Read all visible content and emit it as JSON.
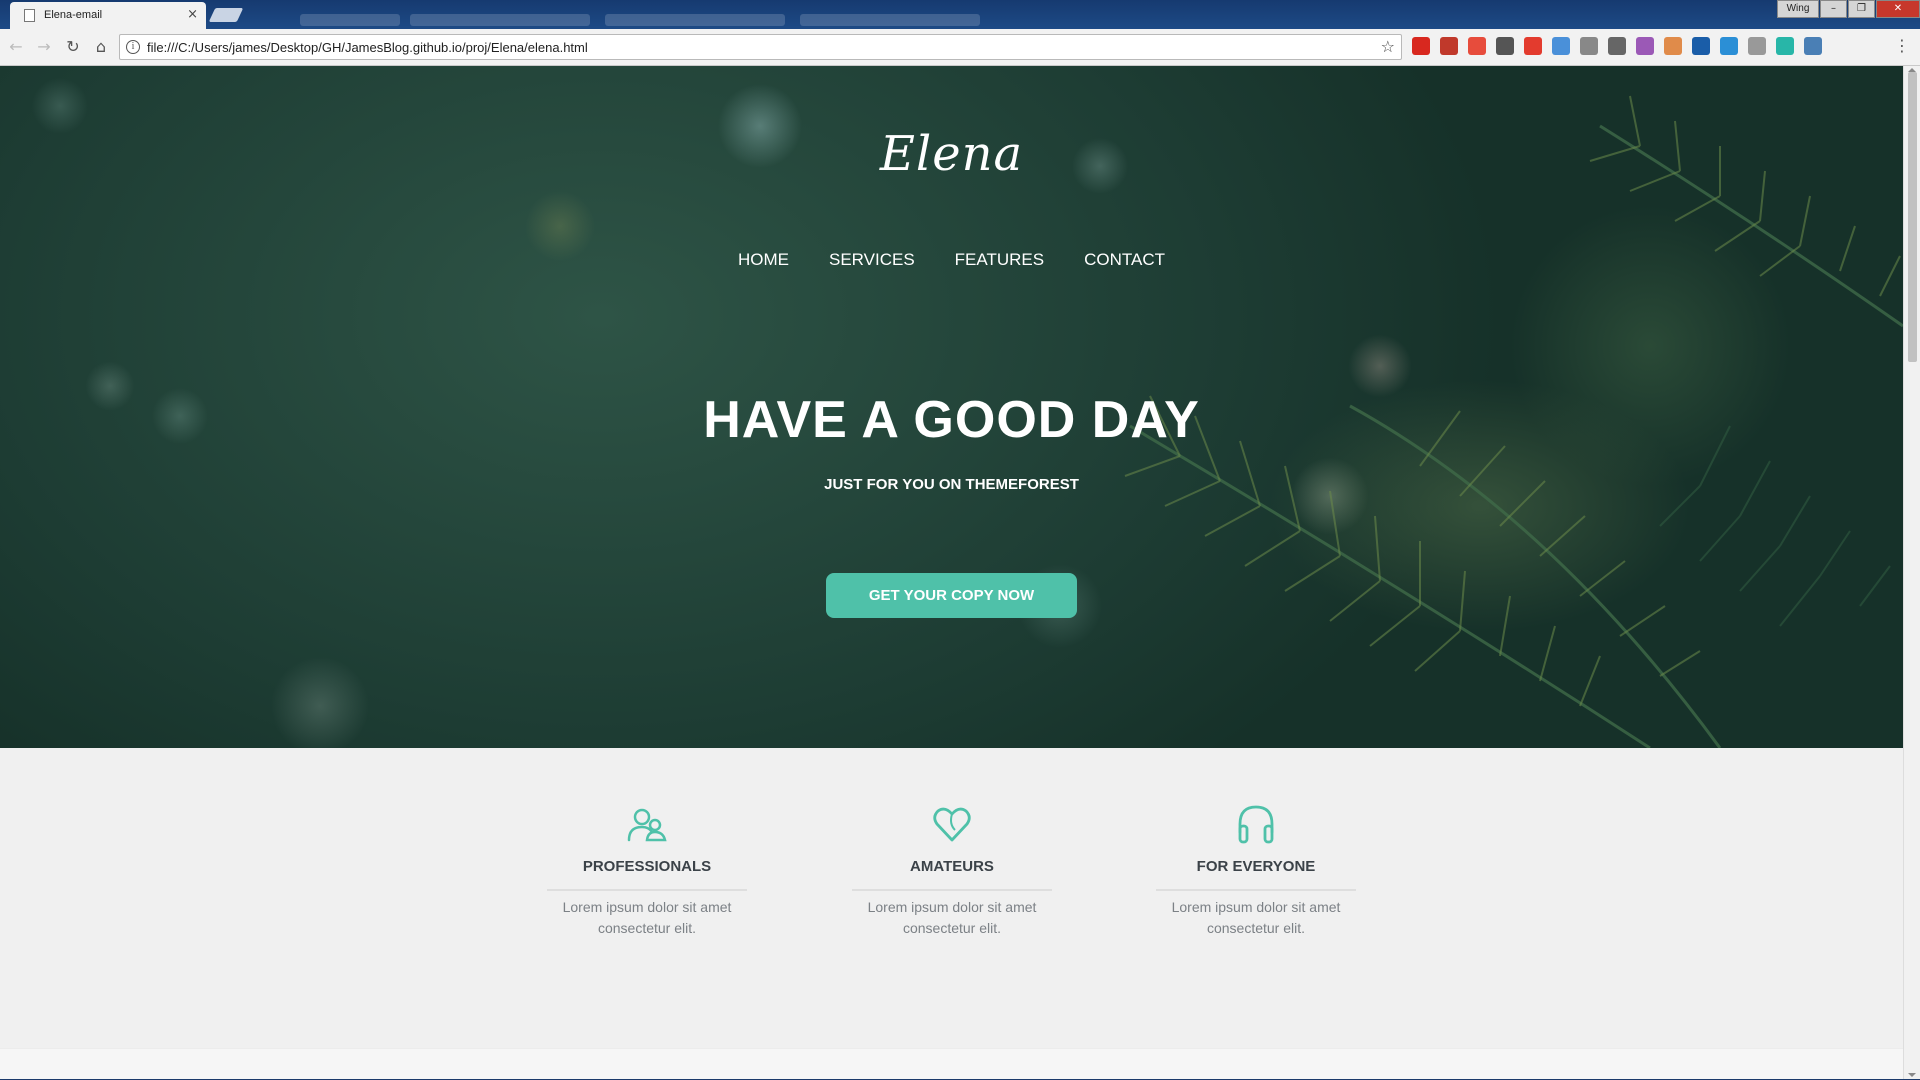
{
  "browser": {
    "tab_title": "Elena-email",
    "tab_close": "×",
    "url": "file:///C:/Users/james/Desktop/GH/JamesBlog.github.io/proj/Elena/elena.html",
    "user_label": "Wing",
    "window_buttons": [
      "–",
      "❐",
      "✕"
    ],
    "nav": {
      "back": "←",
      "forward": "→",
      "reload": "↻",
      "home": "⌂"
    },
    "info_glyph": "i",
    "star": "☆",
    "menu": "⋮",
    "extensions": [
      {
        "name": "opera-icon",
        "color": "#d8281f"
      },
      {
        "name": "media-icon",
        "color": "#c0392b"
      },
      {
        "name": "stack-icon",
        "color": "#e74c3c"
      },
      {
        "name": "search-ext-icon",
        "color": "#555555"
      },
      {
        "name": "red-square-icon",
        "color": "#e33b2e"
      },
      {
        "name": "clock-icon",
        "color": "#4a90d9"
      },
      {
        "name": "box-icon",
        "color": "#888888"
      },
      {
        "name": "screen-icon",
        "color": "#666666"
      },
      {
        "name": "color-wheel-icon",
        "color": "#9b59b6"
      },
      {
        "name": "calendar-icon",
        "color": "#e08b4a"
      },
      {
        "name": "l-icon",
        "color": "#1a5da8"
      },
      {
        "name": "download-icon",
        "color": "#2b8fd6"
      },
      {
        "name": "bracket-icon",
        "color": "#999999"
      },
      {
        "name": "m-icon",
        "color": "#28b6a8"
      },
      {
        "name": "capture-icon",
        "color": "#4a7fb5"
      }
    ]
  },
  "page": {
    "logo": "Elena",
    "nav": [
      "HOME",
      "SERVICES",
      "FEATURES",
      "CONTACT"
    ],
    "headline": "HAVE A GOOD DAY",
    "subhead": "JUST FOR YOU ON THEMEFOREST",
    "cta": "GET YOUR COPY NOW",
    "accent_color": "#4fc1a9",
    "features": [
      {
        "icon": "users-icon",
        "title": "PROFESSIONALS",
        "text": "Lorem ipsum dolor sit amet consectetur elit."
      },
      {
        "icon": "heart-icon",
        "title": "AMATEURS",
        "text": "Lorem ipsum dolor sit amet consectetur elit."
      },
      {
        "icon": "headphones-icon",
        "title": "FOR EVERYONE",
        "text": "Lorem ipsum dolor sit amet consectetur elit."
      }
    ]
  }
}
